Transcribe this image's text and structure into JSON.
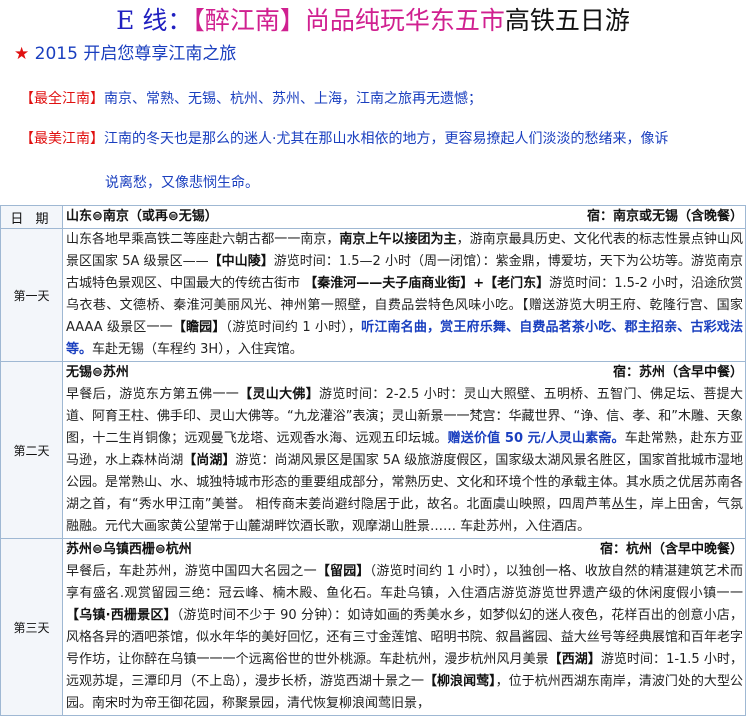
{
  "header": {
    "title_prefix": "E 线：",
    "title_main": "【醉江南】尚品纯玩华东五市",
    "title_tail": "高铁五日游",
    "subtitle_star": "★",
    "subtitle": " 2015 开启您尊享江南之旅"
  },
  "intro": [
    {
      "tag": "【最全江南】",
      "text": "南京、常熟、无锡、杭州、苏州、上海，江南之旅再无遗憾；"
    },
    {
      "tag": "【最美江南】",
      "text": "江南的冬天也是那么的迷人·尤其在那山水相依的地方，更容易撩起人们淡淡的愁绪来，像诉"
    },
    {
      "tag": "",
      "text": "说离愁，又像悲悯生命。"
    }
  ],
  "table": {
    "col_day": "日 期",
    "col_route": "山东⊜南京（或再⊜无锡）",
    "col_stay": "宿：南京或无锡（含晚餐）",
    "days": [
      {
        "label": "第一天",
        "segments": [
          {
            "t": "山东各地早乘高铁二等座赴六朝古都一一南京，",
            "s": "n"
          },
          {
            "t": "南京上午以接团为主",
            "s": "b"
          },
          {
            "t": "，游南京最具历史、文化代表的标志性景点钟山风景区国家 5A 级景区——",
            "s": "n"
          },
          {
            "t": "【中山陵】",
            "s": "b"
          },
          {
            "t": "游览时间：1.5—2 小时（周一闭馆）：紫金鼎，博爱坊，天下为公坊等。游览南京古城特色景观区、中国最大的传统古街市 ",
            "s": "n"
          },
          {
            "t": "【秦淮河——夫子庙商业街】+【老门东】",
            "s": "b"
          },
          {
            "t": "游览时间：1.5-2 小时，沿途欣赏乌衣巷、文德桥、秦淮河美丽风光、神州第一照壁，自费品尝特色风味小吃。【赠送游览大明王府、乾隆行宫、国家 AAAA 级景区一一",
            "s": "n"
          },
          {
            "t": "【瞻园】",
            "s": "b"
          },
          {
            "t": "（游览时间约 1 小时），",
            "s": "n"
          },
          {
            "t": "听江南名曲，赏王府乐舞、自费品茗茶小吃、郡主招亲、古彩戏法等。",
            "s": "h"
          },
          {
            "t": "车赴无锡（车程约 3H），入住宾馆。",
            "s": "n"
          }
        ]
      },
      {
        "label": "第二天",
        "route": "无锡⊜苏州",
        "stay": "宿：苏州（含早中餐）",
        "segments": [
          {
            "t": "早餐后，游览东方第五佛一一",
            "s": "n"
          },
          {
            "t": "【灵山大佛】",
            "s": "b"
          },
          {
            "t": "游览时间：2-2.5 小时：灵山大照壁、五明桥、五智门、佛足坛、菩提大道、阿育王柱、佛手印、灵山大佛等。“九龙灌浴”表演；灵山新景一一梵宫：华藏世界、“诤、信、孝、和”木雕、天象图，十二生肖铜像；远观曼飞龙塔、远观香水海、远观五印坛城。",
            "s": "n"
          },
          {
            "t": "赠送价值 50 元/人灵山素斋。",
            "s": "h"
          },
          {
            "t": "车赴常熟，赴东方亚马逊，水上森林尚湖",
            "s": "n"
          },
          {
            "t": "【尚湖】",
            "s": "b"
          },
          {
            "t": "游览：尚湖风景区是国家 5A 级旅游度假区，国家级太湖风景名胜区，国家首批城市湿地公园。是常熟山、水、城独特城市形态的重要组成部分，常熟历史、文化和环境个性的承载主体。其水质之优居苏南各湖之首，有“秀水甲江南”美誉。 相传商末姜尚避纣隐居于此，故名。北面虞山映照，四周芦苇丛生，岸上田舍，气氛融融。元代大画家黄公望常于山麓湖畔饮酒长歌，观摩湖山胜景…… 车赴苏州，入住酒店。",
            "s": "n"
          }
        ]
      },
      {
        "label": "第三天",
        "route": "苏州⊜乌镇西栅⊜杭州",
        "stay": "宿：杭州（含早中晚餐）",
        "segments": [
          {
            "t": "早餐后，车赴苏州，游览中国四大名园之一",
            "s": "n"
          },
          {
            "t": "【留园】",
            "s": "b"
          },
          {
            "t": "（游览时间约 1 小时），以独创一格、收放自然的精湛建筑艺术而享有盛名.观赏留园三绝：冠云峰、楠木殿、鱼化石。车赴乌镇，入住酒店游览游览世界遗产级的休闲度假小镇一一",
            "s": "n"
          },
          {
            "t": "【乌镇·西栅景区】",
            "s": "b"
          },
          {
            "t": "（游览时间不少于 90 分钟）：如诗如画的秀美水乡，如梦似幻的迷人夜色，花样百出的创意小店，风格各异的酒吧茶馆，似水年华的美好回忆，还有三寸金莲馆、昭明书院、叙昌酱园、益大丝号等经典展馆和百年老字号作坊，让你醉在乌镇一一一个远离俗世的世外桃源。车赴杭州，漫步杭州风月美景",
            "s": "n"
          },
          {
            "t": "【西湖】",
            "s": "b"
          },
          {
            "t": "游览时间：1-1.5 小时，远观苏堤，三潭印月（不上岛），漫步长桥，游览西湖十景之一",
            "s": "n"
          },
          {
            "t": "【柳浪闻莺】",
            "s": "b"
          },
          {
            "t": "，位于杭州西湖东南岸，清波门处的大型公园。南宋时为帝王御花园，称聚景园，清代恢复柳浪闻莺旧景，",
            "s": "n"
          }
        ]
      }
    ]
  }
}
